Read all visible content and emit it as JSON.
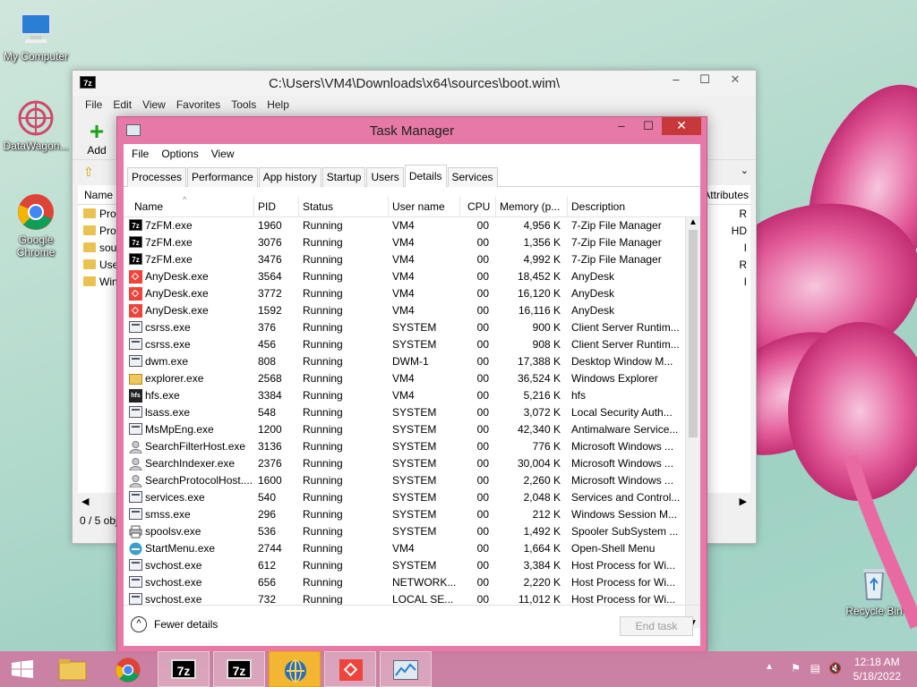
{
  "desktop": {
    "icons": [
      {
        "label": "My Computer"
      },
      {
        "label": "DataWagon..."
      },
      {
        "label": "Google Chrome"
      },
      {
        "label": "Recycle Bin"
      }
    ]
  },
  "zip": {
    "title": "C:\\Users\\VM4\\Downloads\\x64\\sources\\boot.wim\\",
    "icon_text": "7z",
    "menu": [
      "File",
      "Edit",
      "View",
      "Favorites",
      "Tools",
      "Help"
    ],
    "add_label": "Add",
    "col_name": "Name",
    "col_attributes": "Attributes",
    "rows": [
      {
        "name": "Prog",
        "attr": "R"
      },
      {
        "name": "Prog",
        "attr": "HD"
      },
      {
        "name": "sou",
        "attr": "I"
      },
      {
        "name": "Use",
        "attr": "R"
      },
      {
        "name": "Win",
        "attr": "I"
      }
    ],
    "status": "0 / 5 obj"
  },
  "taskmanager": {
    "title": "Task Manager",
    "menu": [
      "File",
      "Options",
      "View"
    ],
    "tabs": [
      "Processes",
      "Performance",
      "App history",
      "Startup",
      "Users",
      "Details",
      "Services"
    ],
    "active_tab": "Details",
    "columns": {
      "name": "Name",
      "pid": "PID",
      "status": "Status",
      "user": "User name",
      "cpu": "CPU",
      "memory": "Memory (p...",
      "description": "Description"
    },
    "rows": [
      {
        "name": "7zFM.exe",
        "pid": "1960",
        "status": "Running",
        "user": "VM4",
        "cpu": "00",
        "memory": "4,956 K",
        "description": "7-Zip File Manager",
        "icon": "7zip-icon"
      },
      {
        "name": "7zFM.exe",
        "pid": "3076",
        "status": "Running",
        "user": "VM4",
        "cpu": "00",
        "memory": "1,356 K",
        "description": "7-Zip File Manager",
        "icon": "7zip-icon"
      },
      {
        "name": "7zFM.exe",
        "pid": "3476",
        "status": "Running",
        "user": "VM4",
        "cpu": "00",
        "memory": "4,992 K",
        "description": "7-Zip File Manager",
        "icon": "7zip-icon"
      },
      {
        "name": "AnyDesk.exe",
        "pid": "3564",
        "status": "Running",
        "user": "VM4",
        "cpu": "00",
        "memory": "18,452 K",
        "description": "AnyDesk",
        "icon": "anydesk-icon"
      },
      {
        "name": "AnyDesk.exe",
        "pid": "3772",
        "status": "Running",
        "user": "VM4",
        "cpu": "00",
        "memory": "16,120 K",
        "description": "AnyDesk",
        "icon": "anydesk-icon"
      },
      {
        "name": "AnyDesk.exe",
        "pid": "1592",
        "status": "Running",
        "user": "VM4",
        "cpu": "00",
        "memory": "16,116 K",
        "description": "AnyDesk",
        "icon": "anydesk-icon"
      },
      {
        "name": "csrss.exe",
        "pid": "376",
        "status": "Running",
        "user": "SYSTEM",
        "cpu": "00",
        "memory": "900 K",
        "description": "Client Server Runtim...",
        "icon": "process-icon"
      },
      {
        "name": "csrss.exe",
        "pid": "456",
        "status": "Running",
        "user": "SYSTEM",
        "cpu": "00",
        "memory": "908 K",
        "description": "Client Server Runtim...",
        "icon": "process-icon"
      },
      {
        "name": "dwm.exe",
        "pid": "808",
        "status": "Running",
        "user": "DWM-1",
        "cpu": "00",
        "memory": "17,388 K",
        "description": "Desktop Window M...",
        "icon": "process-icon"
      },
      {
        "name": "explorer.exe",
        "pid": "2568",
        "status": "Running",
        "user": "VM4",
        "cpu": "00",
        "memory": "36,524 K",
        "description": "Windows Explorer",
        "icon": "explorer-icon"
      },
      {
        "name": "hfs.exe",
        "pid": "3384",
        "status": "Running",
        "user": "VM4",
        "cpu": "00",
        "memory": "5,216 K",
        "description": "hfs",
        "icon": "hfs-icon"
      },
      {
        "name": "lsass.exe",
        "pid": "548",
        "status": "Running",
        "user": "SYSTEM",
        "cpu": "00",
        "memory": "3,072 K",
        "description": "Local Security Auth...",
        "icon": "process-icon"
      },
      {
        "name": "MsMpEng.exe",
        "pid": "1200",
        "status": "Running",
        "user": "SYSTEM",
        "cpu": "00",
        "memory": "42,340 K",
        "description": "Antimalware Service...",
        "icon": "process-icon"
      },
      {
        "name": "SearchFilterHost.exe",
        "pid": "3136",
        "status": "Running",
        "user": "SYSTEM",
        "cpu": "00",
        "memory": "776 K",
        "description": "Microsoft Windows ...",
        "icon": "search-user-icon"
      },
      {
        "name": "SearchIndexer.exe",
        "pid": "2376",
        "status": "Running",
        "user": "SYSTEM",
        "cpu": "00",
        "memory": "30,004 K",
        "description": "Microsoft Windows ...",
        "icon": "search-user-icon"
      },
      {
        "name": "SearchProtocolHost....",
        "pid": "1600",
        "status": "Running",
        "user": "SYSTEM",
        "cpu": "00",
        "memory": "2,260 K",
        "description": "Microsoft Windows ...",
        "icon": "search-user-icon"
      },
      {
        "name": "services.exe",
        "pid": "540",
        "status": "Running",
        "user": "SYSTEM",
        "cpu": "00",
        "memory": "2,048 K",
        "description": "Services and Control...",
        "icon": "process-icon"
      },
      {
        "name": "smss.exe",
        "pid": "296",
        "status": "Running",
        "user": "SYSTEM",
        "cpu": "00",
        "memory": "212 K",
        "description": "Windows Session M...",
        "icon": "process-icon"
      },
      {
        "name": "spoolsv.exe",
        "pid": "536",
        "status": "Running",
        "user": "SYSTEM",
        "cpu": "00",
        "memory": "1,492 K",
        "description": "Spooler SubSystem ...",
        "icon": "printer-icon"
      },
      {
        "name": "StartMenu.exe",
        "pid": "2744",
        "status": "Running",
        "user": "VM4",
        "cpu": "00",
        "memory": "1,664 K",
        "description": "Open-Shell Menu",
        "icon": "startmenu-icon"
      },
      {
        "name": "svchost.exe",
        "pid": "612",
        "status": "Running",
        "user": "SYSTEM",
        "cpu": "00",
        "memory": "3,384 K",
        "description": "Host Process for Wi...",
        "icon": "process-icon"
      },
      {
        "name": "svchost.exe",
        "pid": "656",
        "status": "Running",
        "user": "NETWORK...",
        "cpu": "00",
        "memory": "2,220 K",
        "description": "Host Process for Wi...",
        "icon": "process-icon"
      },
      {
        "name": "svchost.exe",
        "pid": "732",
        "status": "Running",
        "user": "LOCAL SE...",
        "cpu": "00",
        "memory": "11,012 K",
        "description": "Host Process for Wi...",
        "icon": "process-icon"
      }
    ],
    "fewer_details": "Fewer details",
    "end_task": "End task"
  },
  "taskbar": {
    "items": [
      {
        "name": "start-button"
      },
      {
        "name": "file-explorer-button"
      },
      {
        "name": "chrome-button"
      },
      {
        "name": "7zip-button-1",
        "text": "7z"
      },
      {
        "name": "7zip-button-2",
        "text": "7z"
      },
      {
        "name": "datawagon-button"
      },
      {
        "name": "anydesk-button"
      },
      {
        "name": "taskmanager-button"
      }
    ],
    "time": "12:18 AM",
    "date": "5/18/2022"
  },
  "colors": {
    "accent": "#e679a6",
    "taskbar": "#ce7aa0",
    "close": "#c7383a"
  }
}
